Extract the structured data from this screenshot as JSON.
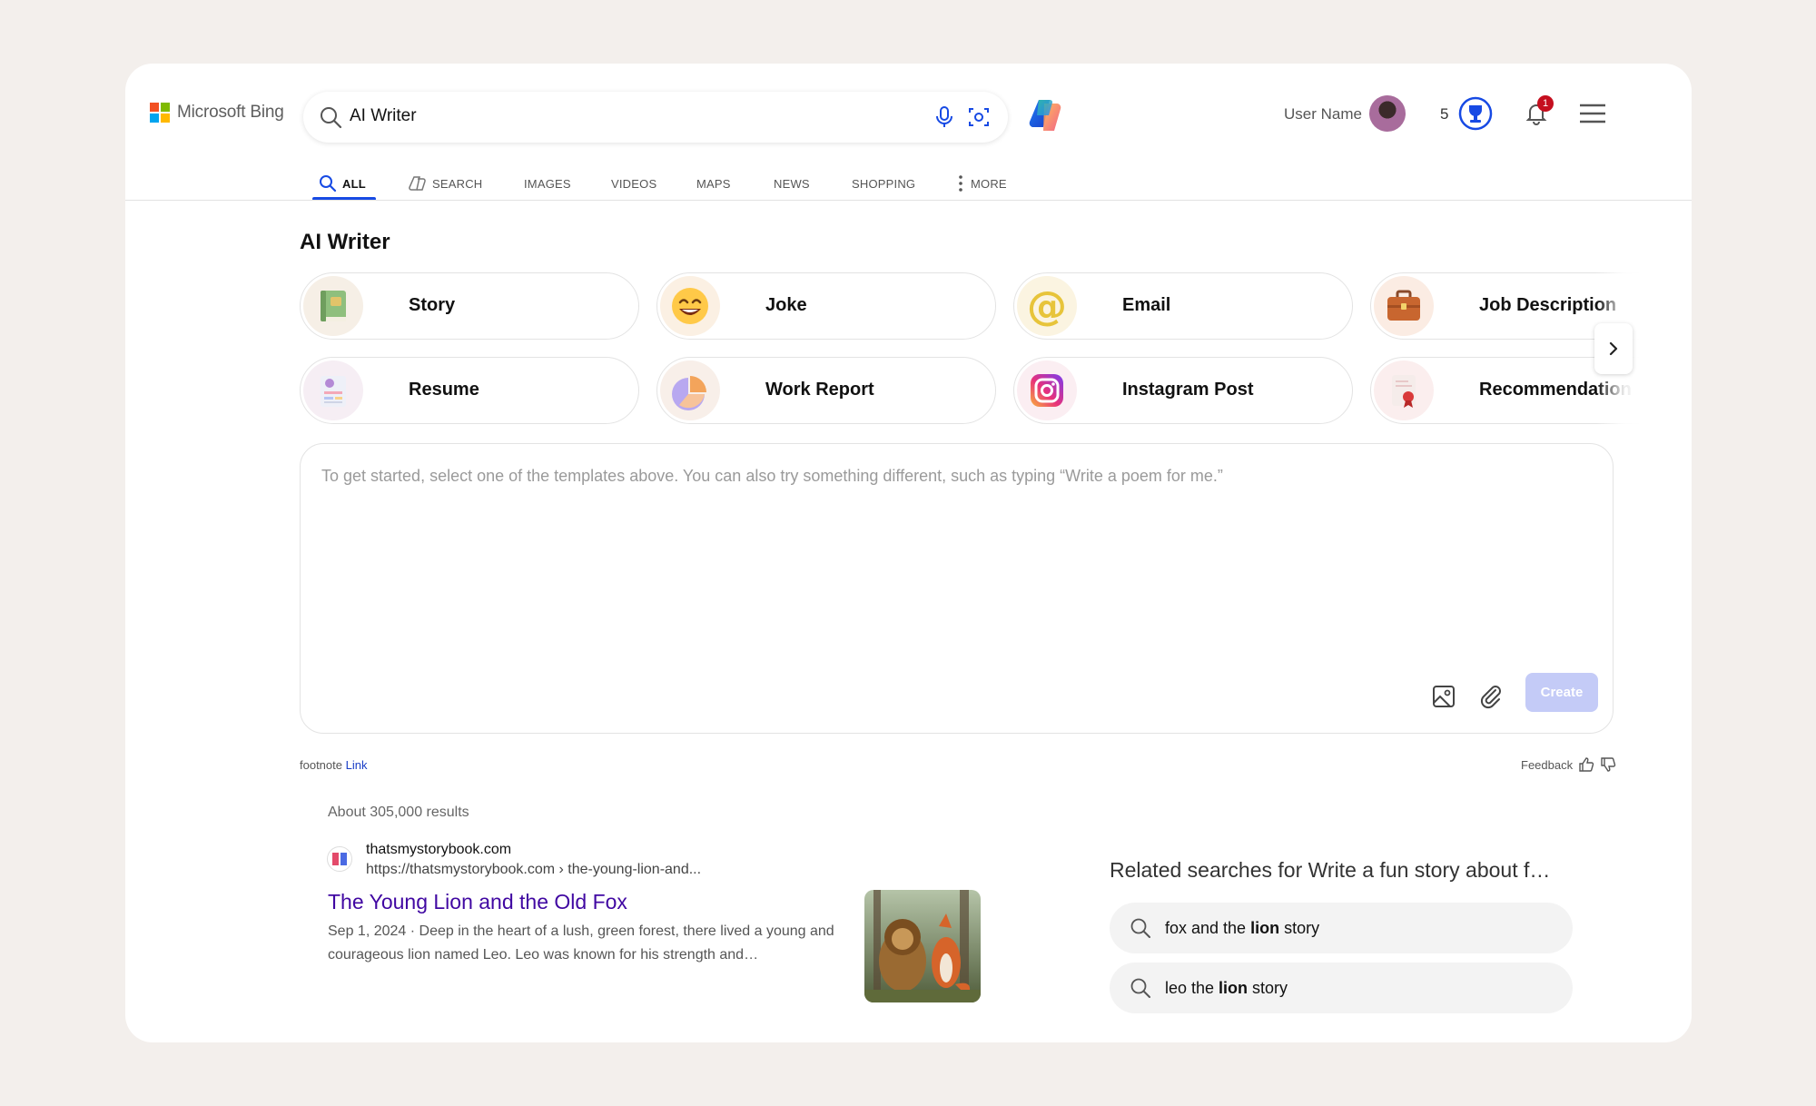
{
  "header": {
    "logo_text": "Microsoft Bing",
    "search_query": "AI Writer",
    "user_name": "User Name",
    "points": "5",
    "notification_count": "1"
  },
  "nav": {
    "tabs": [
      {
        "label": "ALL",
        "icon": "search-icon",
        "active": true
      },
      {
        "label": "SEARCH",
        "icon": "copilot-search-icon",
        "active": false
      },
      {
        "label": "IMAGES",
        "active": false
      },
      {
        "label": "VIDEOS",
        "active": false
      },
      {
        "label": "MAPS",
        "active": false
      },
      {
        "label": "NEWS",
        "active": false
      },
      {
        "label": "SHOPPING",
        "active": false
      },
      {
        "label": "MORE",
        "icon": "more-vertical-icon",
        "active": false
      }
    ]
  },
  "main": {
    "title": "AI Writer",
    "templates": [
      {
        "label": "Story",
        "icon": "book-icon"
      },
      {
        "label": "Joke",
        "icon": "laughing-face-icon"
      },
      {
        "label": "Email",
        "icon": "at-sign-icon"
      },
      {
        "label": "Job Description",
        "icon": "briefcase-icon"
      },
      {
        "label": "Resume",
        "icon": "resume-icon"
      },
      {
        "label": "Work Report",
        "icon": "pie-chart-icon"
      },
      {
        "label": "Instagram Post",
        "icon": "instagram-icon"
      },
      {
        "label": "Recommendation",
        "icon": "certificate-icon"
      }
    ],
    "editor_placeholder": "To get started, select one of the templates above. You can also try something different, such as typing “Write a poem for me.”",
    "create_label": "Create",
    "footnote_text": "footnote",
    "footnote_link": "Link",
    "feedback_label": "Feedback"
  },
  "results": {
    "count": "About 305,000 results",
    "items": [
      {
        "site_name": "thatsmystorybook.com",
        "url": "https://thatsmystorybook.com › the-young-lion-and...",
        "title": "The Young Lion and the Old Fox",
        "snippet": "Sep 1, 2024 · Deep in the heart of a lush, green forest, there lived a young and courageous lion named Leo. Leo was known for his strength and…"
      }
    ],
    "related_title": "Related searches for Write a fun story about f…",
    "related": [
      {
        "pre": "fox and the ",
        "bold": "lion",
        "post": " story"
      },
      {
        "pre": "leo the ",
        "bold": "lion",
        "post": " story"
      }
    ]
  },
  "colors": {
    "accent": "#174ae4",
    "link_title": "#4007a2",
    "create_disabled": "#c4cbf7",
    "badge": "#c50f1f"
  }
}
